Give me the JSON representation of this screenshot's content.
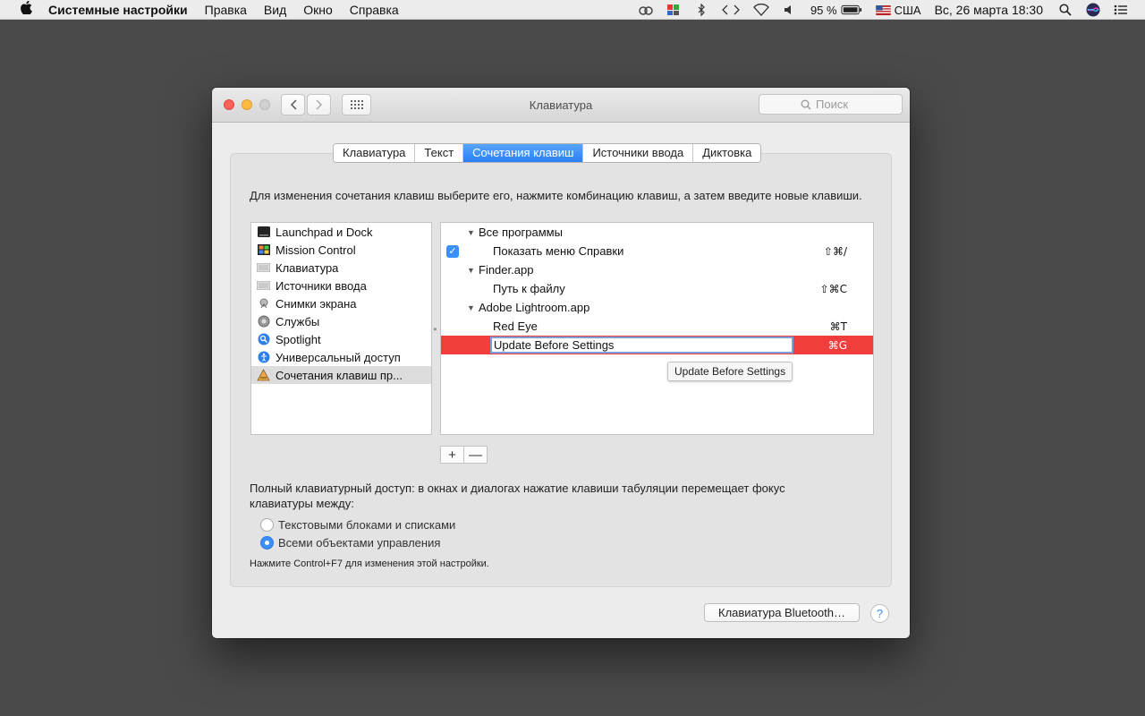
{
  "menubar": {
    "apple": "",
    "app_name": "Системные настройки",
    "items": [
      "Правка",
      "Вид",
      "Окно",
      "Справка"
    ],
    "battery": "95 %",
    "input_source": "США",
    "datetime": "Вс, 26 марта  18:30"
  },
  "window": {
    "title": "Клавиатура",
    "search_placeholder": "Поиск"
  },
  "tabs": [
    {
      "label": "Клавиатура",
      "active": false
    },
    {
      "label": "Текст",
      "active": false
    },
    {
      "label": "Сочетания клавиш",
      "active": true
    },
    {
      "label": "Источники ввода",
      "active": false
    },
    {
      "label": "Диктовка",
      "active": false
    }
  ],
  "description": "Для изменения сочетания клавиш выберите его, нажмите комбинацию клавиш, а затем введите новые клавиши.",
  "categories": [
    {
      "label": "Launchpad и Dock",
      "icon": "launchpad-icon"
    },
    {
      "label": "Mission Control",
      "icon": "mission-control-icon"
    },
    {
      "label": "Клавиатура",
      "icon": "keyboard-icon"
    },
    {
      "label": "Источники ввода",
      "icon": "keyboard-icon"
    },
    {
      "label": "Снимки экрана",
      "icon": "screenshot-icon"
    },
    {
      "label": "Службы",
      "icon": "gear-icon"
    },
    {
      "label": "Spotlight",
      "icon": "spotlight-icon"
    },
    {
      "label": "Универсальный доступ",
      "icon": "accessibility-icon"
    },
    {
      "label": "Сочетания клавиш пр...",
      "icon": "app-shortcuts-icon",
      "selected": true
    }
  ],
  "shortcuts": {
    "group_all": "Все программы",
    "show_help_menu": "Показать меню Справки",
    "show_help_keys": "⇧⌘/",
    "group_finder": "Finder.app",
    "path_to_file": "Путь к файлу",
    "path_to_file_keys": "⇧⌘C",
    "group_lightroom": "Adobe Lightroom.app",
    "red_eye": "Red Eye",
    "red_eye_keys": "⌘T",
    "update_before_settings_keys": "⌘G"
  },
  "editing_value": "Update Before Settings",
  "tooltip": "Update Before Settings",
  "buttons": {
    "plus": "+",
    "minus": "—"
  },
  "access": {
    "text": "Полный клавиатурный доступ: в окнах и диалогах нажатие клавиши табуляции перемещает фокус клавиатуры между:",
    "option1": "Текстовыми блоками и списками",
    "option2": "Всеми объектами управления",
    "selected": 2,
    "note": "Нажмите Control+F7 для изменения этой настройки."
  },
  "bluetooth_button": "Клавиатура Bluetooth…",
  "help_button": "?",
  "colors": {
    "accent": "#3b8ff8",
    "highlight_row": "#f13d3b",
    "background": "#4a4a4a"
  }
}
